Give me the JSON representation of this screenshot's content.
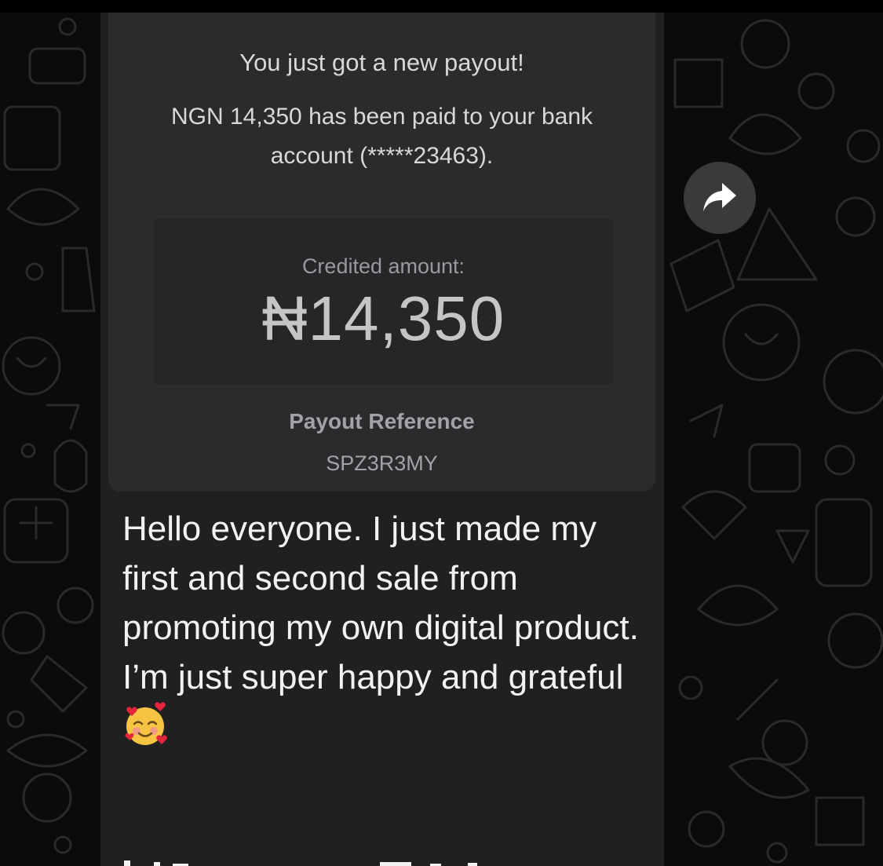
{
  "shared_image": {
    "notice_title": "You just got a new payout!",
    "notice_body": "NGN 14,350 has been paid to your bank account (*****23463).",
    "credited_label": "Credited amount:",
    "credited_amount": "₦14,350",
    "payout_reference_label": "Payout Reference",
    "payout_reference_code": "SPZ3R3MY"
  },
  "message": {
    "text": "Hello everyone. I just made my first and second sale from promoting my own digital product.\nI’m just super happy and grateful",
    "emoji_name": "smiling-face-with-hearts-icon"
  },
  "actions": {
    "forward_icon": "forward-arrow-icon"
  },
  "colors": {
    "wallpaper": "#0b0b0b",
    "bubble": "#202020",
    "card": "#2b2b2d",
    "forward_button": "#3a3a3c"
  }
}
